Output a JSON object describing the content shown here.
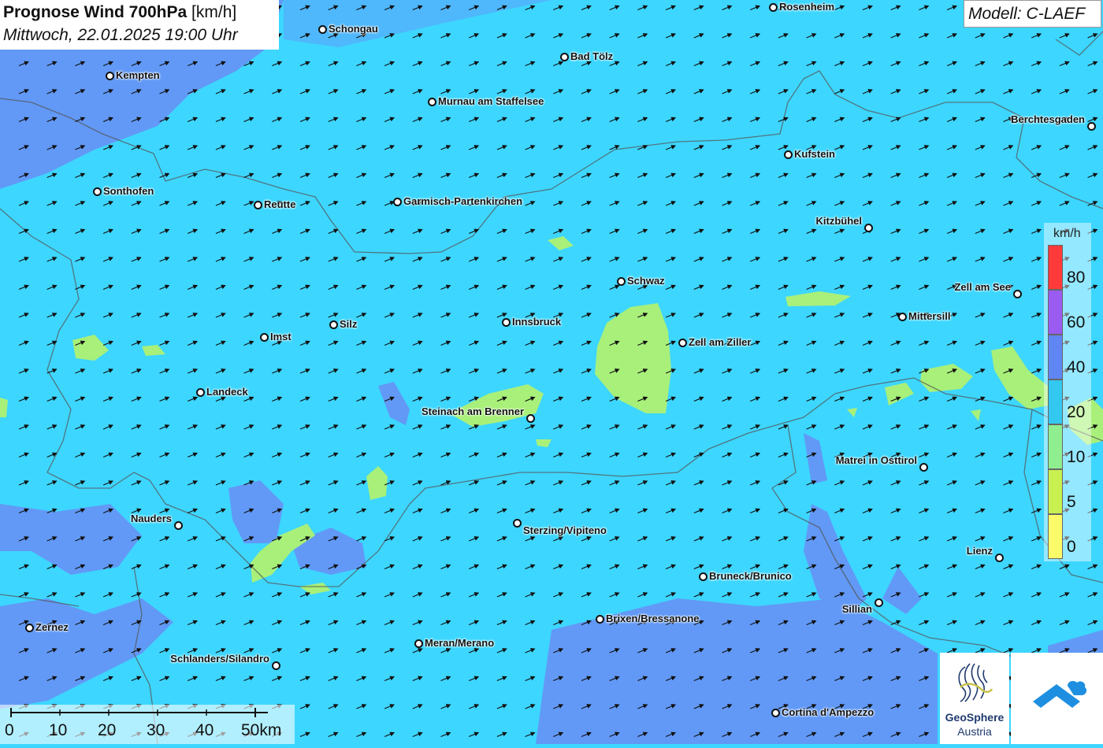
{
  "title": {
    "bold": "Prognose Wind 700hPa",
    "unit": "[km/h]",
    "datetime": "Mittwoch, 22.01.2025 19:00 Uhr"
  },
  "model": "Modell: C-LAEF",
  "legend": {
    "unit": "km/h",
    "labels": [
      "80",
      "60",
      "40",
      "20",
      "10",
      "5",
      "0"
    ],
    "colors": [
      "#ff3a3a",
      "#9a5cf0",
      "#5f86f2",
      "#33c8f0",
      "#8fee8f",
      "#c8f050",
      "#fbfb6a"
    ]
  },
  "scalebar": {
    "labels": [
      "0",
      "10",
      "20",
      "30",
      "40",
      "50km"
    ]
  },
  "logo": {
    "line1": "GeoSphere",
    "line2": "Austria"
  },
  "cities": [
    {
      "name": "Rosenheim"
    },
    {
      "name": "Schongau"
    },
    {
      "name": "Bad Tölz"
    },
    {
      "name": "Kempten"
    },
    {
      "name": "Murnau am Staffelsee"
    },
    {
      "name": "Berchtesgaden"
    },
    {
      "name": "Kufstein"
    },
    {
      "name": "Sonthofen"
    },
    {
      "name": "Reutte"
    },
    {
      "name": "Garmisch-Partenkirchen"
    },
    {
      "name": "Kitzbühel"
    },
    {
      "name": "Schwaz"
    },
    {
      "name": "Zell am See"
    },
    {
      "name": "Mittersill"
    },
    {
      "name": "Silz"
    },
    {
      "name": "Innsbruck"
    },
    {
      "name": "Imst"
    },
    {
      "name": "Zell am Ziller"
    },
    {
      "name": "Landeck"
    },
    {
      "name": "Steinach am Brenner"
    },
    {
      "name": "Matrei in Osttirol"
    },
    {
      "name": "Nauders"
    },
    {
      "name": "Sterzing/Vipiteno"
    },
    {
      "name": "Lienz"
    },
    {
      "name": "Bruneck/Brunico"
    },
    {
      "name": "Sillian"
    },
    {
      "name": "Brixen/Bressanone"
    },
    {
      "name": "Zernez"
    },
    {
      "name": "Meran/Merano"
    },
    {
      "name": "Schlanders/Silandro"
    },
    {
      "name": "Cortina d'Ampezzo"
    }
  ],
  "wind": {
    "direction": "from west-southwest",
    "dominant_range_kmh": "20-40"
  }
}
